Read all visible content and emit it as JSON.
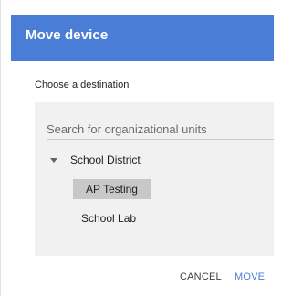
{
  "dialog": {
    "title": "Move device",
    "prompt": "Choose a destination",
    "search": {
      "placeholder": "Search for organizational units",
      "value": ""
    },
    "tree": {
      "root": {
        "label": "School District",
        "expanded": true,
        "icon": "caret-down-icon"
      },
      "children": [
        {
          "label": "AP Testing",
          "selected": true
        },
        {
          "label": "School Lab",
          "selected": false
        }
      ]
    },
    "actions": {
      "cancel_label": "CANCEL",
      "move_label": "MOVE"
    }
  },
  "colors": {
    "header": "#4a7ed6",
    "panel": "#f1f1f1",
    "selected": "#c8c8c8",
    "primary_button": "#4a7ed6"
  }
}
